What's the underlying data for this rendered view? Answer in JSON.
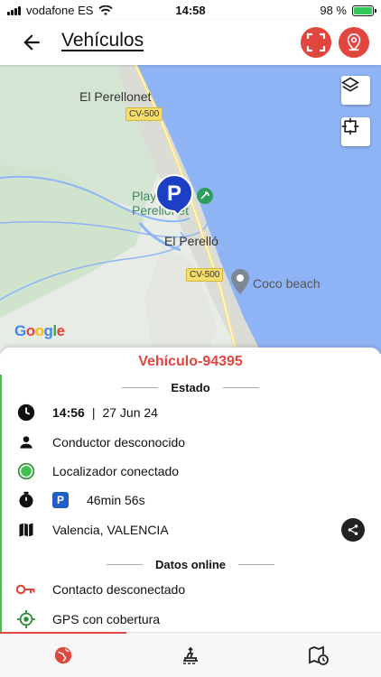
{
  "status_bar": {
    "carrier": "vodafone ES",
    "time": "14:58",
    "battery": "98 %"
  },
  "header": {
    "title": "Vehículos",
    "back_icon": "arrow-left-icon",
    "scan_icon": "focus-frame-icon",
    "location_icon": "map-pin-icon",
    "accent_color": "#e0463e"
  },
  "map": {
    "places": [
      "El Perellonet",
      "Playa Perellonet",
      "El Perelló",
      "Coco beach"
    ],
    "roads": [
      "CV-500",
      "CV-500"
    ],
    "brand": "Google",
    "marker_letter": "P",
    "layers_icon": "layers-icon",
    "center_icon": "crosshair-frame-icon"
  },
  "vehicle": {
    "name": "Vehículo-94395"
  },
  "estado": {
    "heading": "Estado",
    "time": "14:56",
    "separator": "|",
    "date": "27 Jun 24",
    "driver": "Conductor desconocido",
    "locator": "Localizador conectado",
    "parked_badge": "P",
    "parked_duration": "46min 56s",
    "location": "Valencia, VALENCIA"
  },
  "datos_online": {
    "heading": "Datos online",
    "contact": "Contacto desconectado",
    "gps": "GPS con cobertura"
  },
  "colors": {
    "status_green": "#3cc34a",
    "key_red": "#e0463e",
    "gps_green": "#2e8b3a",
    "parking_blue": "#1f5fc7"
  },
  "bottom_nav": {
    "items": [
      "globe-icon",
      "vehicle-control-icon",
      "map-history-icon"
    ]
  }
}
